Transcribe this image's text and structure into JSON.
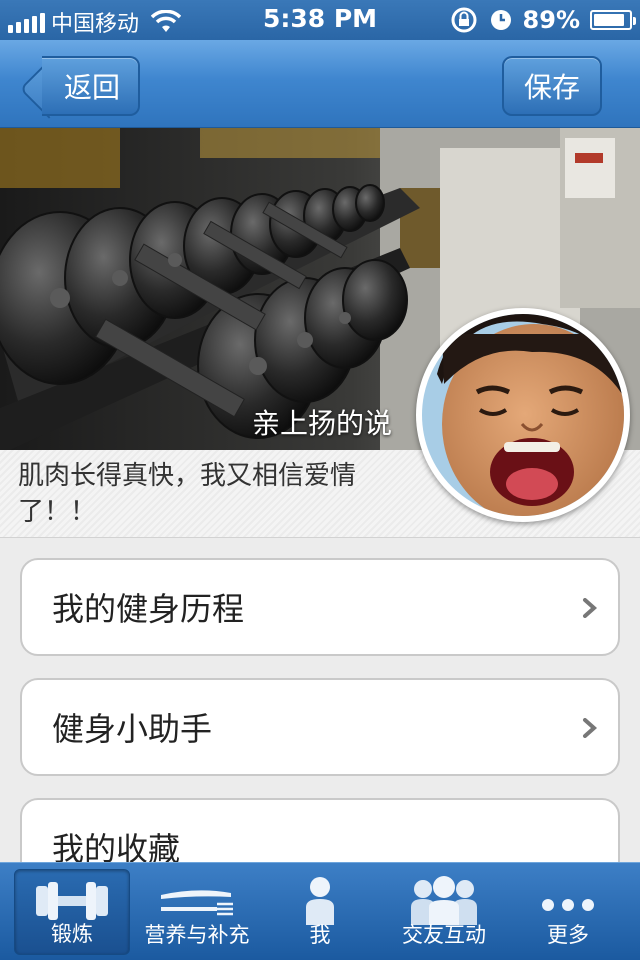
{
  "status_bar": {
    "carrier": "中国移动",
    "time": "5:38 PM",
    "battery_percent": "89%",
    "battery_level": 0.89
  },
  "nav": {
    "back_label": "返回",
    "save_label": "保存"
  },
  "profile": {
    "caption": "亲上扬的说",
    "quote": "肌肉长得真快，我又相信爱情了！！"
  },
  "menu": {
    "items": [
      {
        "label": "我的健身历程"
      },
      {
        "label": "健身小助手"
      },
      {
        "label": "我的收藏"
      }
    ]
  },
  "tabs": [
    {
      "label": "锻炼",
      "icon": "dumbbell-icon",
      "active": true
    },
    {
      "label": "营养与补充",
      "icon": "cutlery-icon",
      "active": false
    },
    {
      "label": "我",
      "icon": "person-icon",
      "active": false
    },
    {
      "label": "交友互动",
      "icon": "group-icon",
      "active": false
    },
    {
      "label": "更多",
      "icon": "more-dots-icon",
      "active": false
    }
  ],
  "colors": {
    "nav_blue": "#3f86cf",
    "tab_blue": "#1b5aa0"
  }
}
